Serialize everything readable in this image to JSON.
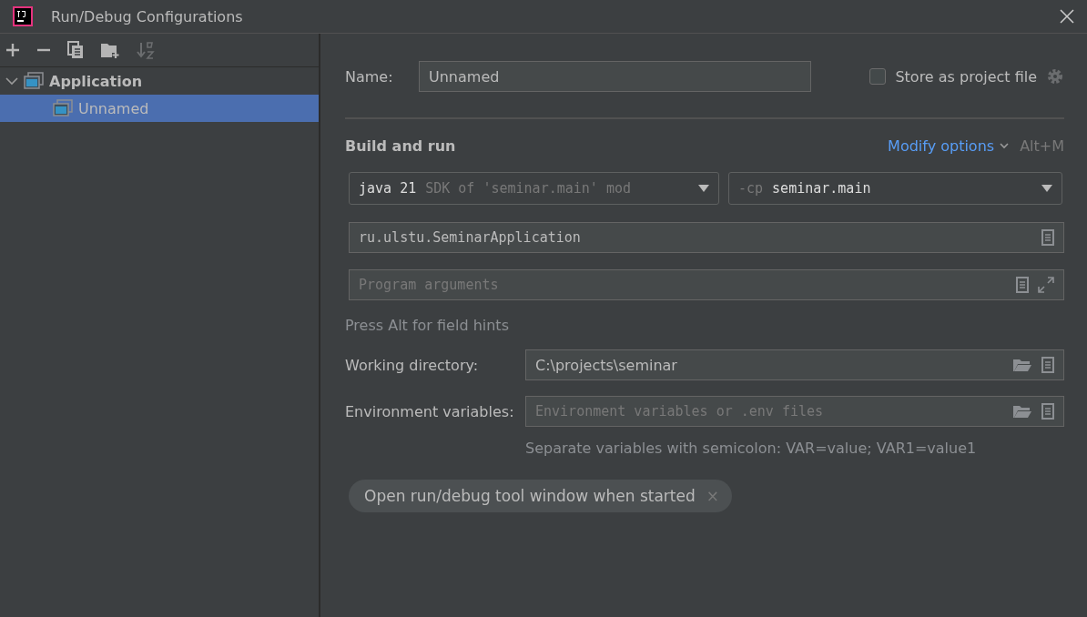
{
  "window": {
    "title": "Run/Debug Configurations"
  },
  "tree": [
    {
      "label": "Application",
      "expanded": true,
      "selected": false,
      "children": [
        {
          "label": "Unnamed",
          "selected": true
        }
      ]
    }
  ],
  "form": {
    "name_label": "Name:",
    "name_value": "Unnamed",
    "store_checkbox": {
      "label": "Store as project file",
      "checked": false
    },
    "section_title": "Build and run",
    "modify_options": "Modify options",
    "shortcut": "Alt+M",
    "jre_dropdown": {
      "value": "java 21",
      "hint": "SDK of 'seminar.main' mod"
    },
    "classpath_dropdown": {
      "prefix": "-cp",
      "value": "seminar.main"
    },
    "main_class": "ru.ulstu.SeminarApplication",
    "program_arguments": {
      "placeholder": "Program arguments"
    },
    "field_hint": "Press Alt for field hints",
    "working_directory": {
      "label": "Working directory:",
      "value": "C:\\projects\\seminar"
    },
    "environment_variables": {
      "label": "Environment variables:",
      "placeholder": "Environment variables or .env files"
    },
    "env_hint": "Separate variables with semicolon: VAR=value; VAR1=value1",
    "chip": {
      "label": "Open run/debug tool window when started",
      "close": "×"
    }
  }
}
